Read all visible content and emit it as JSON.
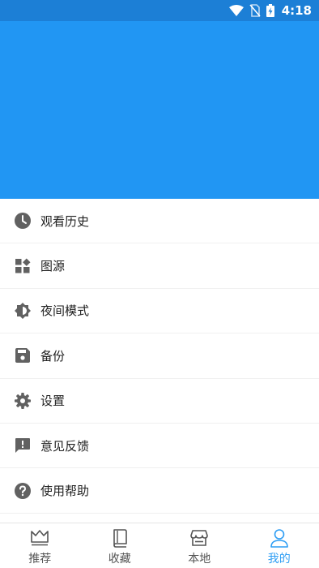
{
  "status_bar": {
    "time": "4:18"
  },
  "menu": {
    "items": [
      {
        "label": "观看历史",
        "icon": "clock-icon"
      },
      {
        "label": "图源",
        "icon": "widgets-icon"
      },
      {
        "label": "夜间模式",
        "icon": "brightness-icon"
      },
      {
        "label": "备份",
        "icon": "save-icon"
      },
      {
        "label": "设置",
        "icon": "gear-icon"
      },
      {
        "label": "意见反馈",
        "icon": "feedback-icon"
      },
      {
        "label": "使用帮助",
        "icon": "help-icon"
      }
    ]
  },
  "bottom_nav": {
    "items": [
      {
        "label": "推荐",
        "icon": "crown-icon"
      },
      {
        "label": "收藏",
        "icon": "book-icon"
      },
      {
        "label": "本地",
        "icon": "store-icon"
      },
      {
        "label": "我的",
        "icon": "person-icon",
        "active": true
      }
    ]
  },
  "colors": {
    "primary": "#2196f3",
    "status_bar": "#1c7fd6",
    "active": "#2f9ef4",
    "icon_gray": "#616161"
  }
}
